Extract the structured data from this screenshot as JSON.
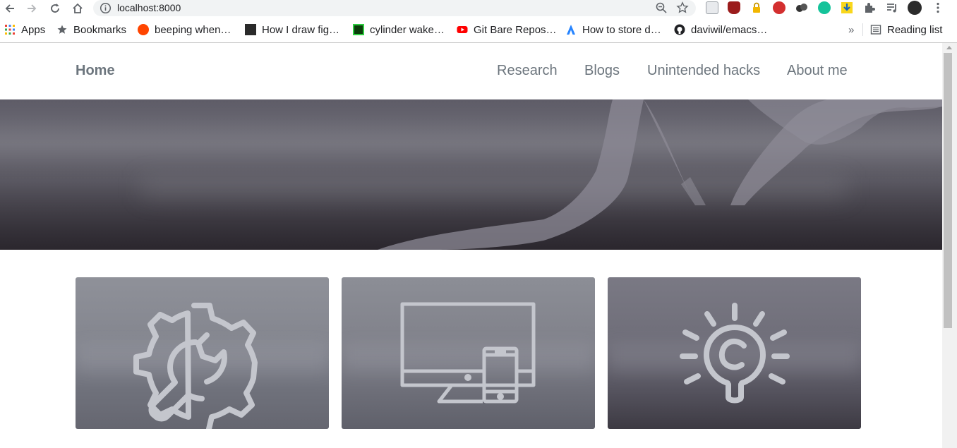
{
  "browser": {
    "url": "localhost:8000",
    "bookmarks": [
      {
        "label": "Apps",
        "icon": "apps-grid-icon"
      },
      {
        "label": "Bookmarks",
        "icon": "star-icon"
      },
      {
        "label": "beeping when…",
        "icon": "reddit-icon"
      },
      {
        "label": "How I draw fig…",
        "icon": "portrait-icon"
      },
      {
        "label": "cylinder wake…",
        "icon": "swirl-icon"
      },
      {
        "label": "Git Bare Repos…",
        "icon": "youtube-icon"
      },
      {
        "label": "How to store d…",
        "icon": "atlassian-icon"
      },
      {
        "label": "daviwil/emacs…",
        "icon": "github-icon"
      }
    ],
    "overflow_label": "»",
    "reading_list_label": "Reading list"
  },
  "site": {
    "brand": "Home",
    "nav": [
      "Research",
      "Blogs",
      "Unintended hacks",
      "About me"
    ]
  },
  "cards": [
    {
      "icon": "gear-wrench-icon"
    },
    {
      "icon": "devices-icon"
    },
    {
      "icon": "lightbulb-copyright-icon"
    }
  ],
  "colors": {
    "nav_text": "#6c757d",
    "icon_stroke": "#c4c6cd"
  }
}
